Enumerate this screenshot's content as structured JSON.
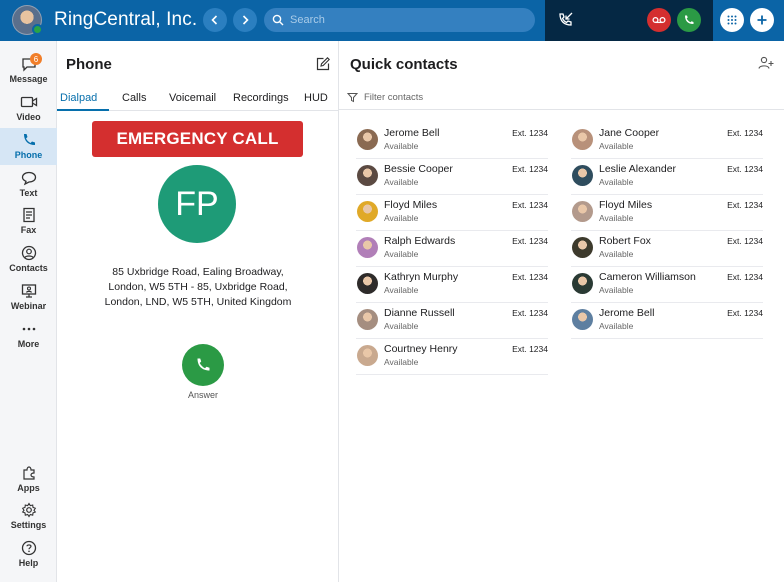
{
  "header": {
    "brand": "RingCentral, Inc.",
    "search_placeholder": "Search"
  },
  "nav": {
    "items": [
      {
        "label": "Message",
        "icon": "message-icon",
        "badge": "6"
      },
      {
        "label": "Video",
        "icon": "video-icon"
      },
      {
        "label": "Phone",
        "icon": "phone-icon",
        "active": true
      },
      {
        "label": "Text",
        "icon": "text-icon"
      },
      {
        "label": "Fax",
        "icon": "fax-icon"
      },
      {
        "label": "Contacts",
        "icon": "contacts-icon"
      },
      {
        "label": "Webinar",
        "icon": "webinar-icon"
      },
      {
        "label": "More",
        "icon": "more-icon"
      }
    ],
    "bottom": [
      {
        "label": "Apps",
        "icon": "apps-icon"
      },
      {
        "label": "Settings",
        "icon": "settings-icon"
      },
      {
        "label": "Help",
        "icon": "help-icon"
      }
    ]
  },
  "phone": {
    "title": "Phone",
    "tabs": [
      "Dialpad",
      "Calls",
      "Voicemail",
      "Recordings",
      "HUD"
    ],
    "emergency_label": "EMERGENCY CALL",
    "caller_initials": "FP",
    "address_lines": [
      "85 Uxbridge Road, Ealing Broadway,",
      "London, W5 5TH - 85, Uxbridge Road,",
      "London, LND, W5 5TH, United Kingdom"
    ],
    "answer_label": "Answer"
  },
  "quick_contacts": {
    "title": "Quick contacts",
    "filter_placeholder": "Filter contacts",
    "left": [
      {
        "name": "Jerome Bell",
        "status": "Available",
        "ext": "Ext. 1234",
        "color": "#8a6a52"
      },
      {
        "name": "Bessie Cooper",
        "status": "Available",
        "ext": "Ext. 1234",
        "color": "#5b4a42"
      },
      {
        "name": "Floyd Miles",
        "status": "Available",
        "ext": "Ext. 1234",
        "color": "#e0a928"
      },
      {
        "name": "Ralph Edwards",
        "status": "Available",
        "ext": "Ext. 1234",
        "color": "#b17fb8"
      },
      {
        "name": "Kathryn Murphy",
        "status": "Available",
        "ext": "Ext. 1234",
        "color": "#2e2b2a"
      },
      {
        "name": "Dianne Russell",
        "status": "Available",
        "ext": "Ext. 1234",
        "color": "#a58e80"
      },
      {
        "name": "Courtney Henry",
        "status": "Available",
        "ext": "Ext. 1234",
        "color": "#c9a98f"
      }
    ],
    "right": [
      {
        "name": "Jane Cooper",
        "status": "Available",
        "ext": "Ext. 1234",
        "color": "#b8917a"
      },
      {
        "name": "Leslie Alexander",
        "status": "Available",
        "ext": "Ext. 1234",
        "color": "#2f4d5e"
      },
      {
        "name": "Floyd Miles",
        "status": "Available",
        "ext": "Ext. 1234",
        "color": "#b39a8c"
      },
      {
        "name": "Robert Fox",
        "status": "Available",
        "ext": "Ext. 1234",
        "color": "#3d3a2c"
      },
      {
        "name": "Cameron Williamson",
        "status": "Available",
        "ext": "Ext. 1234",
        "color": "#2a3a34"
      },
      {
        "name": "Jerome Bell",
        "status": "Available",
        "ext": "Ext. 1234",
        "color": "#5e7fa0"
      }
    ]
  },
  "colors": {
    "header": "#0b64a6",
    "call_zone": "#052844",
    "emergency": "#d42f2f",
    "caller_avatar": "#1e9b77",
    "answer": "#2b9a45",
    "accent": "#066fac"
  }
}
